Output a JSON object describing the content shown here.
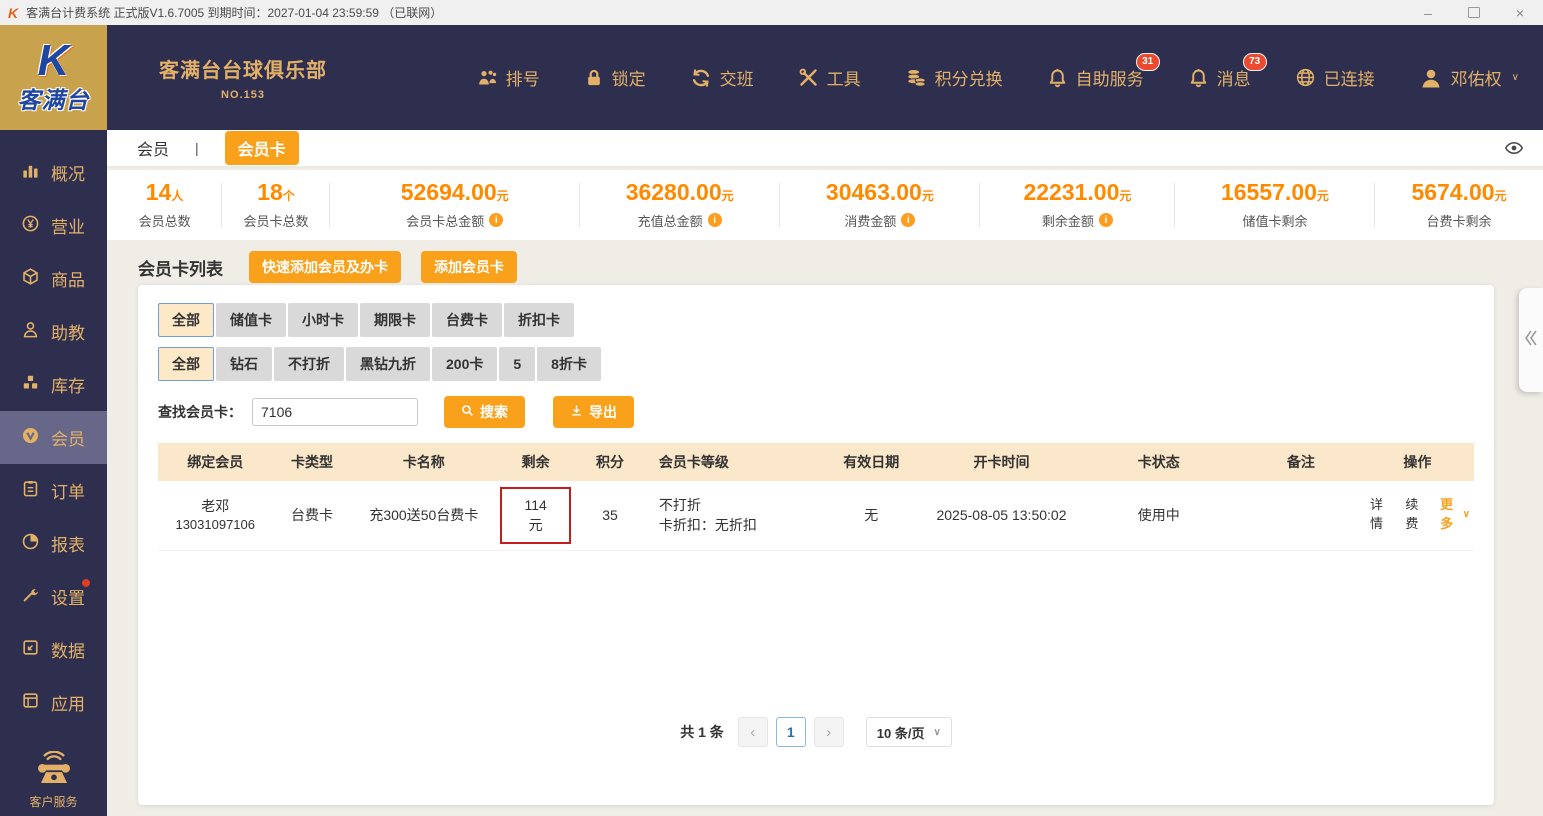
{
  "title_bar": {
    "logo": "K",
    "app_title": "客满台计费系统 正式版V1.6.7005 到期时间：2027-01-04 23:59:59 （已联网）",
    "controls": {
      "minimize": "–",
      "close": "×"
    }
  },
  "logo_block": {
    "brand_k": "K",
    "brand_name": "客满台"
  },
  "header": {
    "club_name": "客满台台球俱乐部",
    "club_no": "NO.153",
    "nav": [
      {
        "label": "排号",
        "icon": "queue-people"
      },
      {
        "label": "锁定",
        "icon": "lock"
      },
      {
        "label": "交班",
        "icon": "shift-exchange"
      },
      {
        "label": "工具",
        "icon": "tools"
      },
      {
        "label": "积分兑换",
        "icon": "coins"
      },
      {
        "label": "自助服务",
        "icon": "bell",
        "badge": "31"
      },
      {
        "label": "消息",
        "icon": "bell",
        "badge": "73"
      },
      {
        "label": "已连接",
        "icon": "globe"
      },
      {
        "label": "邓佑权",
        "icon": "user"
      }
    ]
  },
  "sidebar": {
    "items": [
      {
        "label": "概况"
      },
      {
        "label": "营业"
      },
      {
        "label": "商品"
      },
      {
        "label": "助教"
      },
      {
        "label": "库存"
      },
      {
        "label": "会员",
        "active": true
      },
      {
        "label": "订单"
      },
      {
        "label": "报表"
      },
      {
        "label": "设置",
        "alert_dot": true
      },
      {
        "label": "数据"
      },
      {
        "label": "应用"
      }
    ],
    "footer_label": "客户服务"
  },
  "tabs": {
    "items": [
      {
        "label": "会员"
      },
      {
        "label": "会员卡",
        "active": true
      }
    ]
  },
  "stats": [
    {
      "value": "14",
      "unit": "人",
      "label": "会员总数",
      "info": false
    },
    {
      "value": "18",
      "unit": "个",
      "label": "会员卡总数",
      "info": false
    },
    {
      "value": "52694.00",
      "unit": "元",
      "label": "会员卡总金额",
      "info": true
    },
    {
      "value": "36280.00",
      "unit": "元",
      "label": "充值总金额",
      "info": true
    },
    {
      "value": "30463.00",
      "unit": "元",
      "label": "消费金额",
      "info": true
    },
    {
      "value": "22231.00",
      "unit": "元",
      "label": "剩余金额",
      "info": true
    },
    {
      "value": "16557.00",
      "unit": "元",
      "label": "储值卡剩余",
      "info": false
    },
    {
      "value": "5674.00",
      "unit": "元",
      "label": "台费卡剩余",
      "info": false
    }
  ],
  "section": {
    "title": "会员卡列表",
    "quick_add_label": "快速添加会员及办卡",
    "add_card_label": "添加会员卡"
  },
  "filters": {
    "type_row": [
      {
        "label": "全部",
        "selected": true
      },
      {
        "label": "储值卡"
      },
      {
        "label": "小时卡"
      },
      {
        "label": "期限卡"
      },
      {
        "label": "台费卡"
      },
      {
        "label": "折扣卡"
      }
    ],
    "level_row": [
      {
        "label": "全部",
        "selected": true
      },
      {
        "label": "钻石"
      },
      {
        "label": "不打折"
      },
      {
        "label": "黑钻九折"
      },
      {
        "label": "200卡"
      },
      {
        "label": "5"
      },
      {
        "label": "8折卡"
      }
    ]
  },
  "search": {
    "label": "查找会员卡：",
    "value": "7106",
    "search_label": "搜索",
    "export_label": "导出"
  },
  "table": {
    "columns": [
      "绑定会员",
      "卡类型",
      "卡名称",
      "剩余",
      "积分",
      "会员卡等级",
      "有效日期",
      "开卡时间",
      "卡状态",
      "备注",
      "操作"
    ],
    "row": {
      "member_name": "老邓",
      "member_phone": "13031097106",
      "card_type": "台费卡",
      "card_name": "充300送50台费卡",
      "remaining": "114元",
      "remaining_highlighted": true,
      "points": "35",
      "level": "不打折",
      "level_discount": "卡折扣：无折扣",
      "valid_date": "无",
      "open_time": "2025-08-05 13:50:02",
      "status": "使用中",
      "remark": "",
      "action_detail": "详情",
      "action_renew": "续费",
      "action_more": "更多"
    }
  },
  "pagination": {
    "total": "共 1 条",
    "page": "1",
    "page_size": "10 条/页"
  },
  "glyphs": {
    "prev": "‹",
    "next": "›",
    "caret": "∨",
    "tab_sep": "|"
  },
  "colors": {
    "accent_orange": "#f9a11b",
    "stat_orange": "#ff8a00",
    "header_navy": "#2e2e4e",
    "gold": "#e2b167",
    "logo_gold_bg": "#c9a24e",
    "badge_red": "#eb4a2f",
    "table_header_bg": "#fbe7c9",
    "highlight_red": "#c41c1c",
    "filter_selected_bg": "#fde8c8",
    "filter_selected_border": "#6f9fd8"
  }
}
